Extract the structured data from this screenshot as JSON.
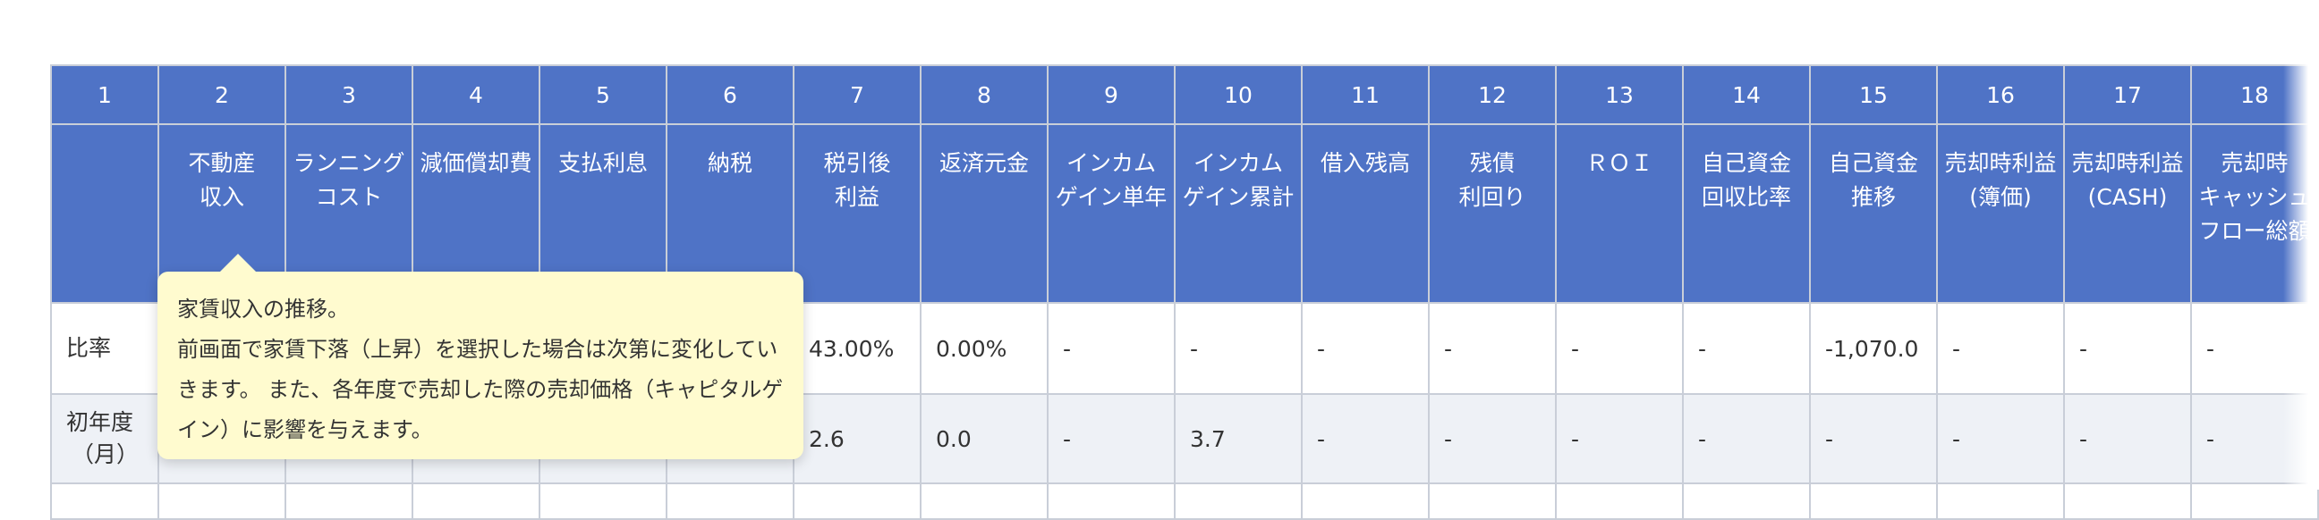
{
  "columns": [
    {
      "num": "1",
      "lines": []
    },
    {
      "num": "2",
      "lines": [
        "不動産",
        "収入"
      ]
    },
    {
      "num": "3",
      "lines": [
        "ランニング",
        "コスト"
      ]
    },
    {
      "num": "4",
      "lines": [
        "減価償却費"
      ]
    },
    {
      "num": "5",
      "lines": [
        "支払利息"
      ]
    },
    {
      "num": "6",
      "lines": [
        "納税"
      ]
    },
    {
      "num": "7",
      "lines": [
        "税引後",
        "利益"
      ]
    },
    {
      "num": "8",
      "lines": [
        "返済元金"
      ]
    },
    {
      "num": "9",
      "lines": [
        "インカム",
        "ゲイン単年"
      ]
    },
    {
      "num": "10",
      "lines": [
        "インカム",
        "ゲイン累計"
      ]
    },
    {
      "num": "11",
      "lines": [
        "借入残高"
      ]
    },
    {
      "num": "12",
      "lines": [
        "残債",
        "利回り"
      ]
    },
    {
      "num": "13",
      "lines": [
        "ＲＯＩ"
      ]
    },
    {
      "num": "14",
      "lines": [
        "自己資金",
        "回収比率"
      ]
    },
    {
      "num": "15",
      "lines": [
        "自己資金",
        "推移"
      ]
    },
    {
      "num": "16",
      "lines": [
        "売却時利益",
        "(簿価)"
      ]
    },
    {
      "num": "17",
      "lines": [
        "売却時利益",
        "(CASH)"
      ]
    },
    {
      "num": "18",
      "lines": [
        "売却時",
        "キャッシュ",
        "フロー総額"
      ]
    }
  ],
  "rows": [
    {
      "label": [
        "比率"
      ],
      "cells": [
        "",
        "",
        "",
        "",
        "",
        "43.00%",
        "0.00%",
        "-",
        "-",
        "-",
        "-",
        "-",
        "-",
        "-1,070.0",
        "-",
        "-",
        "-"
      ]
    },
    {
      "label": [
        "初年度",
        "（月）"
      ],
      "cells": [
        "",
        "",
        "",
        "",
        "",
        "2.6",
        "0.0",
        "-",
        "3.7",
        "-",
        "-",
        "-",
        "-",
        "-",
        "-",
        "-",
        "-"
      ]
    },
    {
      "label": [
        ""
      ],
      "cells": [
        "",
        "",
        "",
        "",
        "",
        "",
        "",
        "",
        "",
        "",
        "",
        "",
        "",
        "",
        "",
        "",
        ""
      ]
    }
  ],
  "tooltip": {
    "lines": [
      "家賃収入の推移。",
      "前画面で家賃下落（上昇）を選択した場合は次第に変化してい",
      "きます。 また、各年度で売却した際の売却価格（キャピタルゲ",
      "イン）に影響を与えます。"
    ]
  },
  "colors": {
    "header_bg": "#4f73c6",
    "tooltip_bg": "#fffbcf"
  }
}
